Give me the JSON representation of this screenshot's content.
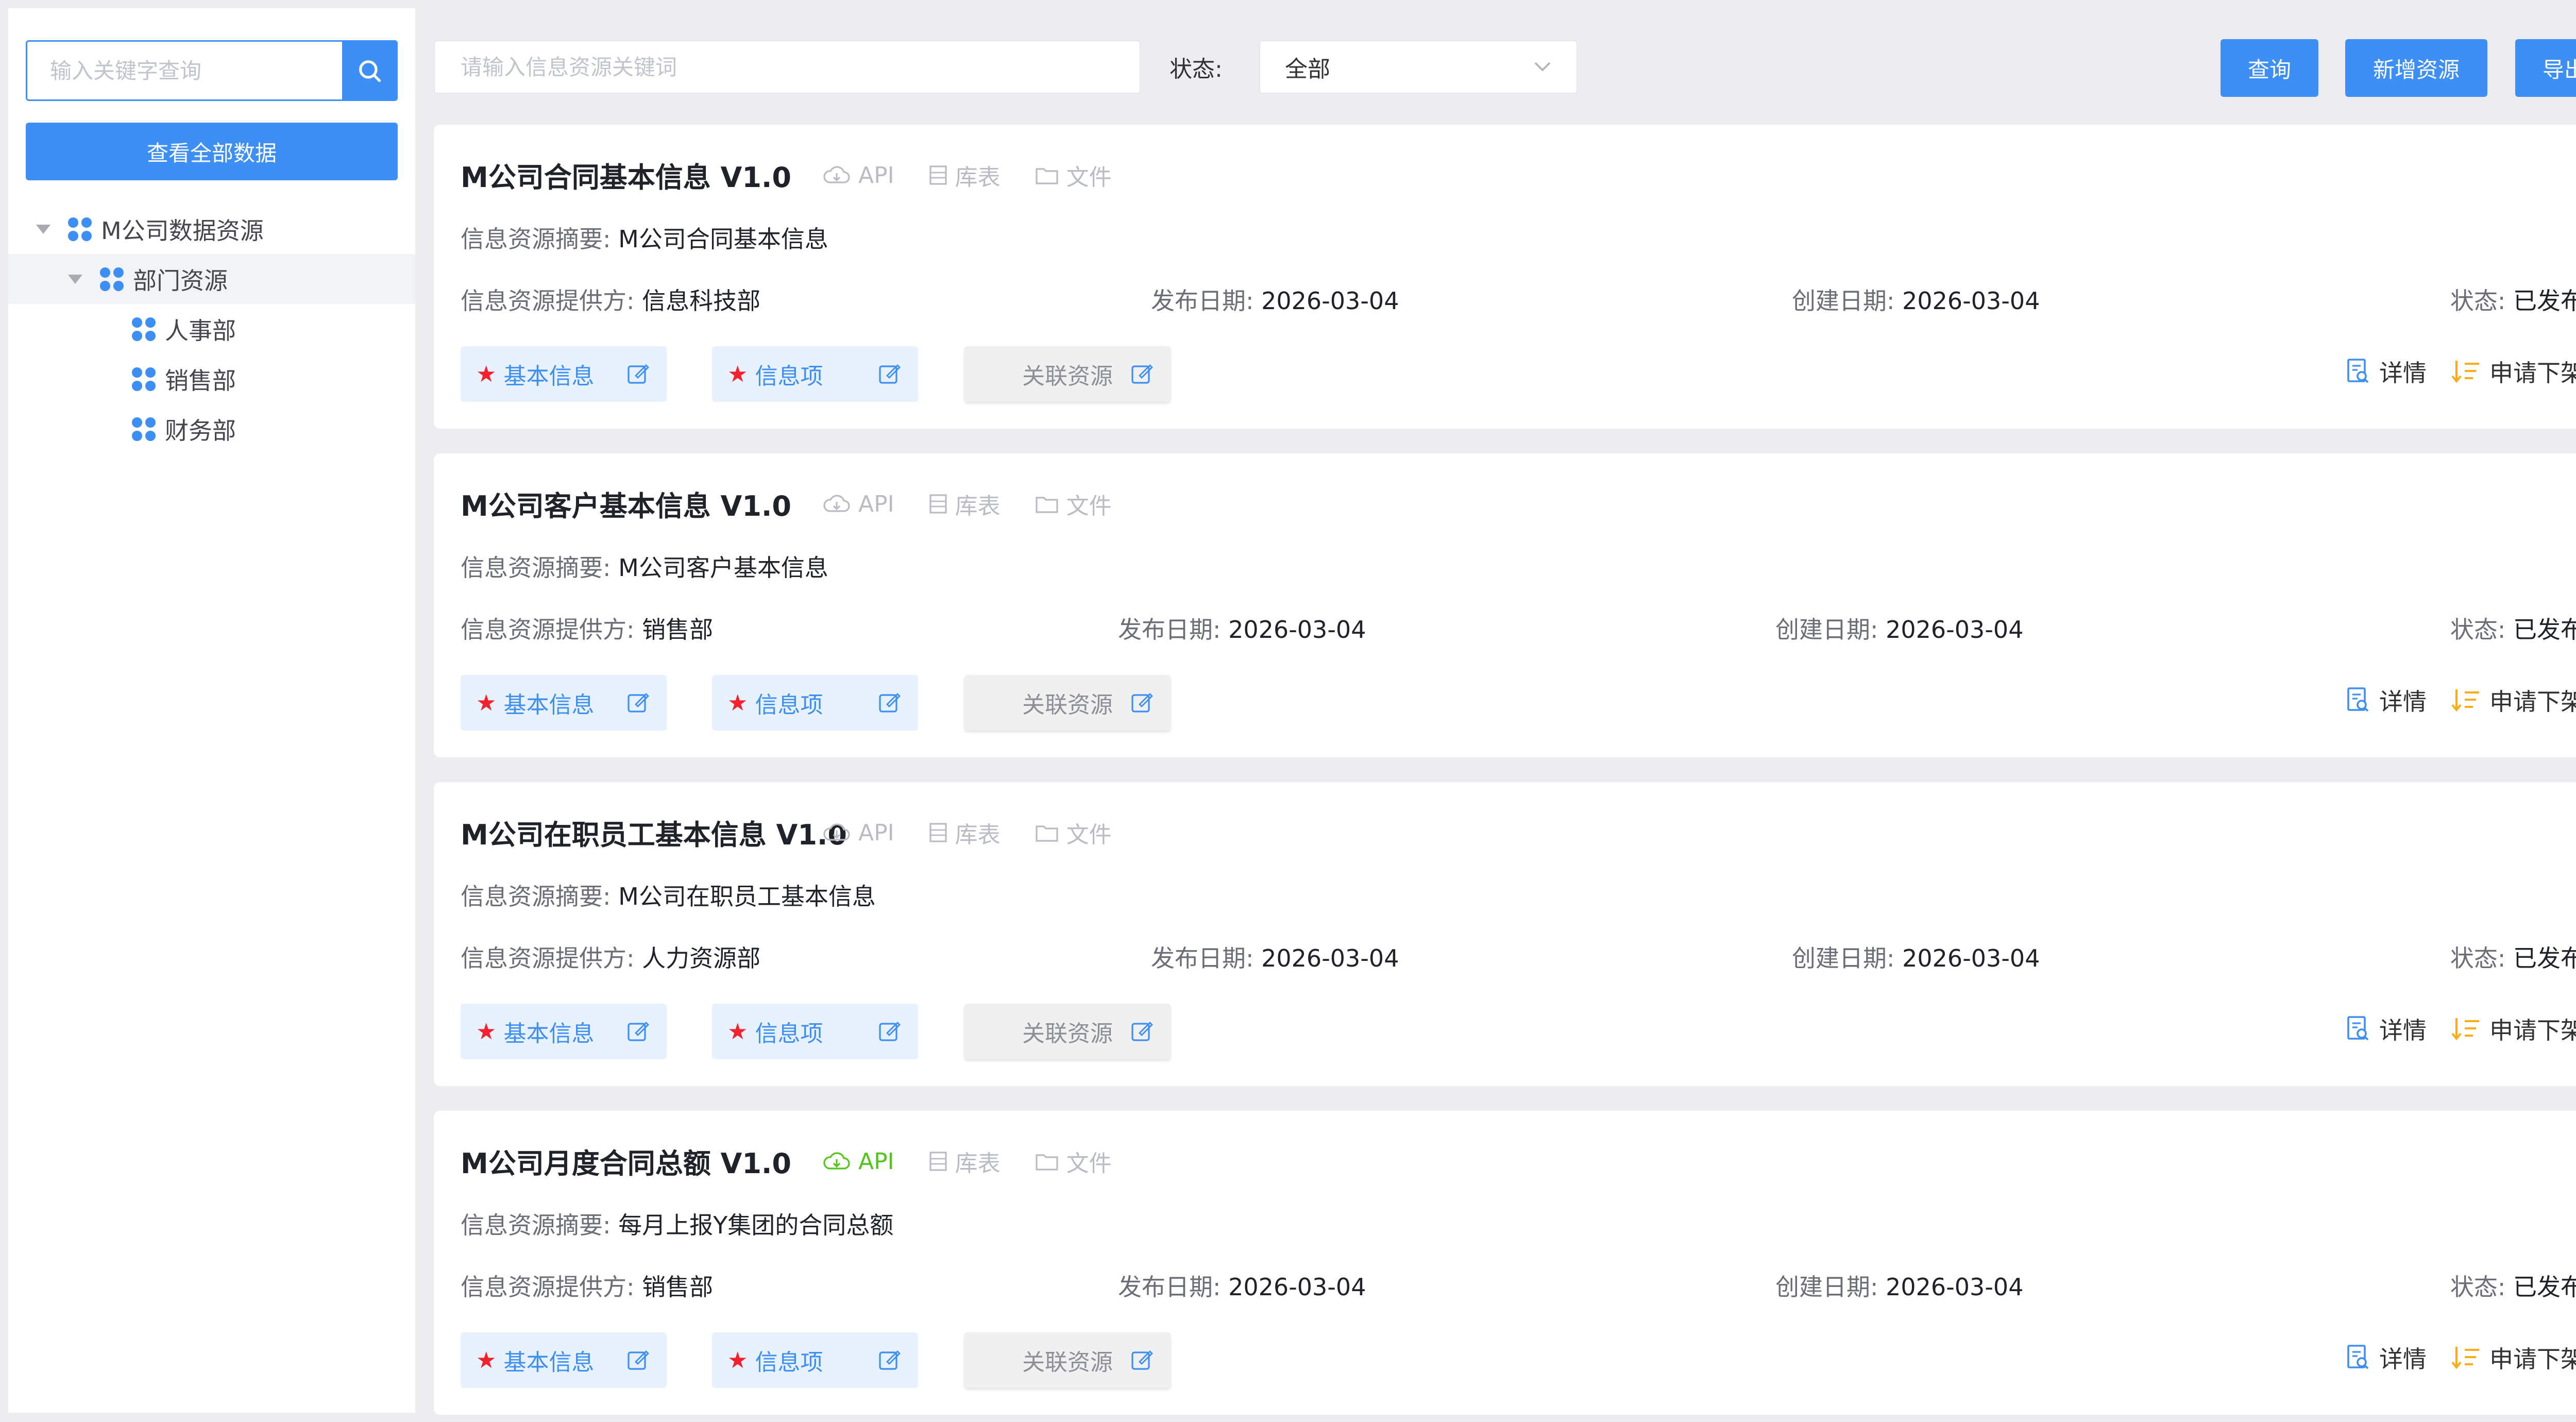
{
  "sidebar": {
    "search_placeholder": "输入关键字查询",
    "view_all_label": "查看全部数据",
    "tree": [
      {
        "label": "M公司数据资源",
        "level": 0,
        "expanded": true
      },
      {
        "label": "部门资源",
        "level": 1,
        "expanded": true,
        "active": true
      },
      {
        "label": "人事部",
        "level": 2
      },
      {
        "label": "销售部",
        "level": 2
      },
      {
        "label": "财务部",
        "level": 2
      }
    ]
  },
  "toolbar": {
    "search_placeholder": "请输入信息资源关键词",
    "status_label": "状态:",
    "status_value": "全部",
    "query_label": "查询",
    "add_label": "新增资源",
    "export_label": "导出"
  },
  "labels": {
    "summary": "信息资源摘要:",
    "provider": "信息资源提供方:",
    "publish_date": "发布日期:",
    "create_date": "创建日期:",
    "status": "状态:",
    "tag_api": "API",
    "tag_table": "库表",
    "tag_file": "文件",
    "basic_info": "基本信息",
    "info_items": "信息项",
    "related": "关联资源",
    "detail": "详情",
    "delist": "申请下架"
  },
  "colors": {
    "primary": "#3d8ff5",
    "api_active": "#52c41a",
    "required_star": "#f5222d",
    "delist_icon": "#faad14"
  },
  "cards": [
    {
      "title": "M公司合同基本信息 V1.0",
      "summary": "M公司合同基本信息",
      "provider": "信息科技部",
      "publish_date": "2026-03-04",
      "create_date": "2026-03-04",
      "status": "已发布",
      "api_active": false
    },
    {
      "title": "M公司客户基本信息 V1.0",
      "summary": "M公司客户基本信息",
      "provider": "销售部",
      "publish_date": "2026-03-04",
      "create_date": "2026-03-04",
      "status": "已发布",
      "api_active": false
    },
    {
      "title": "M公司在职员工基本信息 V1.0",
      "summary": "M公司在职员工基本信息",
      "provider": "人力资源部",
      "publish_date": "2026-03-04",
      "create_date": "2026-03-04",
      "status": "已发布",
      "api_active": false
    },
    {
      "title": "M公司月度合同总额 V1.0",
      "summary": "每月上报Y集团的合同总额",
      "provider": "销售部",
      "publish_date": "2026-03-04",
      "create_date": "2026-03-04",
      "status": "已发布",
      "api_active": true
    }
  ]
}
